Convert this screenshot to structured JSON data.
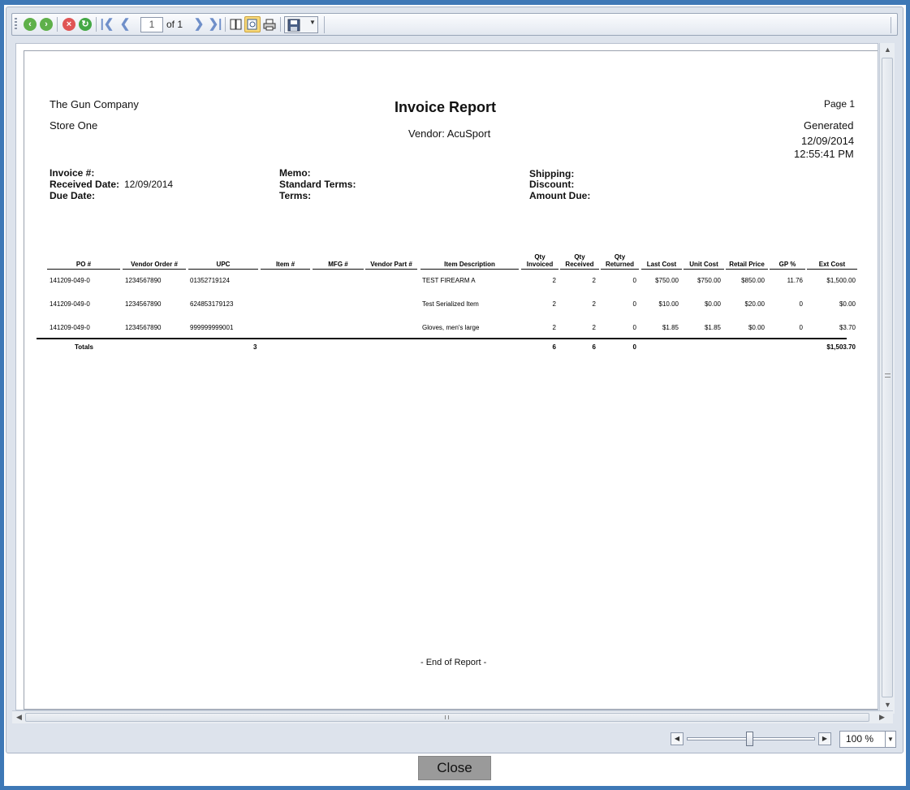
{
  "toolbar": {
    "page_number": "1",
    "page_of": "of 1",
    "icons": [
      "back-icon",
      "forward-icon",
      "stop-icon",
      "refresh-icon",
      "first-page-icon",
      "previous-page-icon",
      "next-page-icon",
      "last-page-icon",
      "document-map-icon",
      "page-layout-icon",
      "print-icon",
      "save-icon"
    ]
  },
  "report": {
    "company": "The Gun Company",
    "store": "Store One",
    "title": "Invoice Report",
    "vendor": "Vendor: AcuSport",
    "page": "Page 1",
    "generated_label": "Generated",
    "generated_date": "12/09/2014",
    "generated_time": "12:55:41 PM",
    "meta": {
      "invoice_label": "Invoice #:",
      "received_label": "Received Date:",
      "received_value": "12/09/2014",
      "due_label": "Due Date:",
      "memo_label": "Memo:",
      "standard_terms_label": "Standard Terms:",
      "terms_label": "Terms:",
      "shipping_label": "Shipping:",
      "discount_label": "Discount:",
      "amount_due_label": "Amount Due:"
    },
    "columns": {
      "po": "PO #",
      "vendor_order": "Vendor Order #",
      "upc": "UPC",
      "item": "Item #",
      "mfg": "MFG #",
      "vendor_part": "Vendor  Part #",
      "description": "Item Description",
      "qty_invoiced_1": "Qty",
      "qty_invoiced_2": "Invoiced",
      "qty_received_1": "Qty",
      "qty_received_2": "Received",
      "qty_returned_1": "Qty",
      "qty_returned_2": "Returned",
      "last_cost": "Last Cost",
      "unit_cost": "Unit Cost",
      "retail_price": "Retail Price",
      "gp": "GP %",
      "ext_cost": "Ext Cost"
    },
    "rows": [
      {
        "po": "141209-049-0",
        "vendor_order": "1234567890",
        "upc": "01352719124",
        "description": "TEST FIREARM A",
        "qty_invoiced": "2",
        "qty_received": "2",
        "qty_returned": "0",
        "last_cost": "$750.00",
        "unit_cost": "$750.00",
        "retail_price": "$850.00",
        "gp": "11.76",
        "ext_cost": "$1,500.00"
      },
      {
        "po": "141209-049-0",
        "vendor_order": "1234567890",
        "upc": "624853179123",
        "description": "Test Serialized Item",
        "qty_invoiced": "2",
        "qty_received": "2",
        "qty_returned": "0",
        "last_cost": "$10.00",
        "unit_cost": "$0.00",
        "retail_price": "$20.00",
        "gp": "0",
        "ext_cost": "$0.00"
      },
      {
        "po": "141209-049-0",
        "vendor_order": "1234567890",
        "upc": "999999999001",
        "description": "Gloves, men's large",
        "qty_invoiced": "2",
        "qty_received": "2",
        "qty_returned": "0",
        "last_cost": "$1.85",
        "unit_cost": "$1.85",
        "retail_price": "$0.00",
        "gp": "0",
        "ext_cost": "$3.70"
      }
    ],
    "totals": {
      "label": "Totals",
      "count": "3",
      "qty_invoiced": "6",
      "qty_received": "6",
      "qty_returned": "0",
      "ext_cost": "$1,503.70"
    },
    "end": "- End of Report -"
  },
  "zoom": {
    "value": "100 %",
    "level_percent": 100
  },
  "close_label": "Close"
}
